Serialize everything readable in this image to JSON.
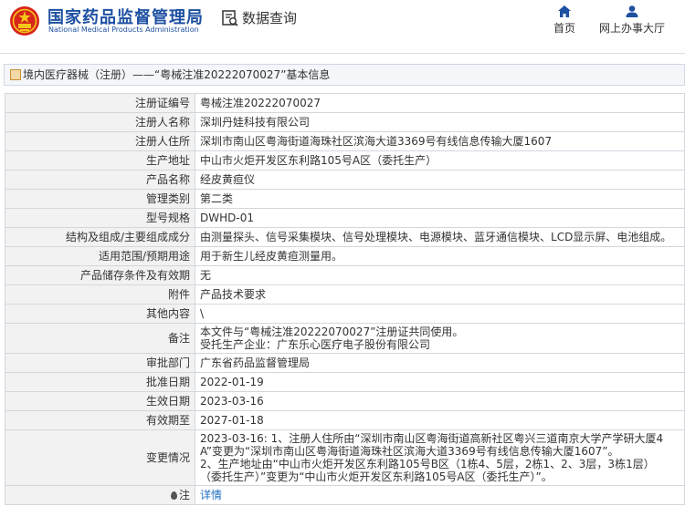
{
  "header": {
    "brand_cn": "国家药品监督管理局",
    "brand_en": "National Medical Products Administration",
    "query_label": "数据查询",
    "nav_home": "首页",
    "nav_office": "网上办事大厅"
  },
  "breadcrumb": "境内医疗器械（注册）——“粤械注准20222070027”基本信息",
  "rows": [
    {
      "label": "注册证编号",
      "value": "粤械注准20222070027"
    },
    {
      "label": "注册人名称",
      "value": "深圳丹娃科技有限公司"
    },
    {
      "label": "注册人住所",
      "value": "深圳市南山区粤海街道海珠社区滨海大道3369号有线信息传输大厦1607"
    },
    {
      "label": "生产地址",
      "value": "中山市火炬开发区东利路105号A区（委托生产）"
    },
    {
      "label": "产品名称",
      "value": "经皮黄疸仪"
    },
    {
      "label": "管理类别",
      "value": "第二类"
    },
    {
      "label": "型号规格",
      "value": "DWHD-01"
    },
    {
      "label": "结构及组成/主要组成成分",
      "value": "由测量探头、信号采集模块、信号处理模块、电源模块、蓝牙通信模块、LCD显示屏、电池组成。"
    },
    {
      "label": "适用范围/预期用途",
      "value": "用于新生儿经皮黄疸测量用。"
    },
    {
      "label": "产品储存条件及有效期",
      "value": "无"
    },
    {
      "label": "附件",
      "value": "产品技术要求"
    },
    {
      "label": "其他内容",
      "value": "\\"
    },
    {
      "label": "备注",
      "lines": [
        "本文件与“粤械注准20222070027”注册证共同使用。",
        "受托生产企业：广东乐心医疗电子股份有限公司"
      ]
    },
    {
      "label": "审批部门",
      "value": "广东省药品监督管理局"
    },
    {
      "label": "批准日期",
      "value": "2022-01-19"
    },
    {
      "label": "生效日期",
      "value": "2023-03-16"
    },
    {
      "label": "有效期至",
      "value": "2027-01-18"
    },
    {
      "label": "变更情况",
      "lines": [
        "2023-03-16: 1、注册人住所由“深圳市南山区粤海街道高新社区粤兴三道南京大学产学研大厦4",
        "A”变更为“深圳市南山区粤海街道海珠社区滨海大道3369号有线信息传输大厦1607”。",
        "2、生产地址由“中山市火炬开发区东利路105号B区（1栋4、5层，2栋1、2、3层，3栋1层）",
        "（委托生产）”变更为“中山市火炬开发区东利路105号A区（委托生产）”。"
      ]
    },
    {
      "label": "注",
      "value": "详情"
    }
  ],
  "colors": {
    "brand_blue": "#1e50a2",
    "label_bg": "#f2f2f2",
    "border": "#d2d7de",
    "link": "#1e6fc0"
  }
}
